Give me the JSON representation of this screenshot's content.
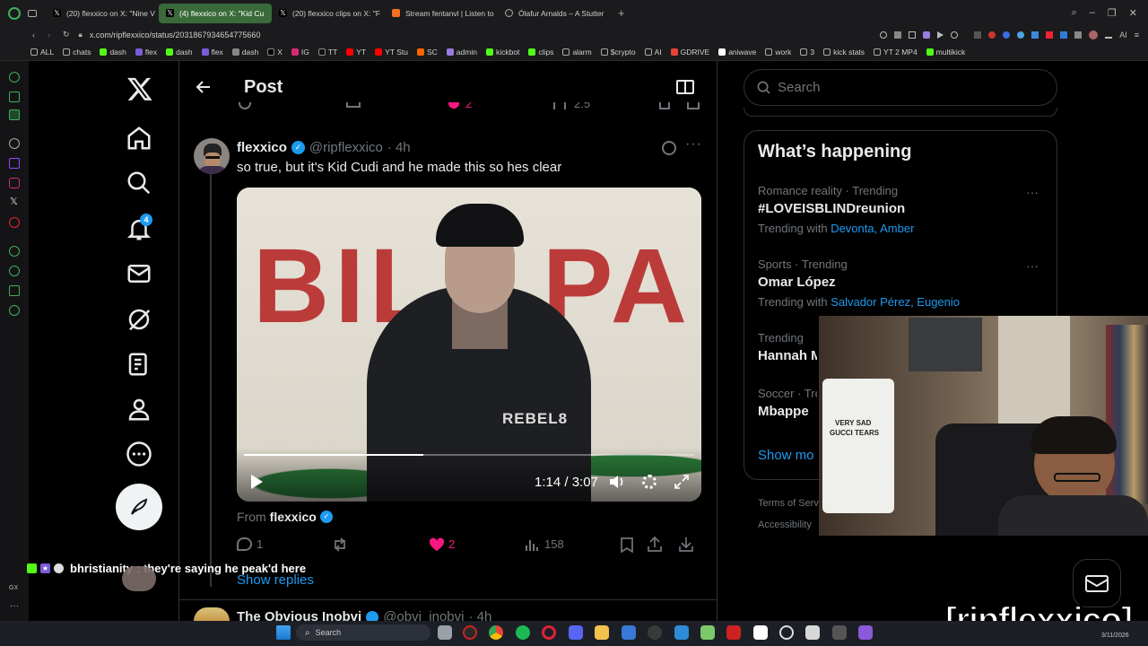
{
  "browser": {
    "tabs": [
      {
        "label": "(20) flexxico on X: \"Nine V",
        "active": false
      },
      {
        "label": "(4) flexxico on X: \"Kid Cu",
        "active": true
      },
      {
        "label": "(20) flexxico clips on X: \"F",
        "active": false
      },
      {
        "label": "Stream fentanvl | Listen to",
        "active": false
      },
      {
        "label": "Ólafur Arnalds – A Stutter",
        "active": false
      }
    ],
    "url": "x.com/ripflexxico/status/2031867934654775660",
    "bookmarks": [
      "ALL",
      "chats",
      "dash",
      "flex",
      "dash",
      "flex",
      "dash",
      "X",
      "IG",
      "TT",
      "YT",
      "YT Stu",
      "SC",
      "admin",
      "kickbot",
      "clips",
      "alarm",
      "$crypto",
      "AI",
      "GDRIVE",
      "aniwave",
      "work",
      "3",
      "kick stats",
      "YT 2 MP4",
      "multikick"
    ],
    "ai_label": "AI"
  },
  "nav": {
    "notifications_count": "4"
  },
  "header": {
    "title": "Post"
  },
  "prev_tweet": {
    "likes": "2",
    "views": "2.5"
  },
  "tweet": {
    "display_name": "flexxico",
    "handle": "@ripflexxico",
    "time": "· 4h",
    "text": "so true, but it's Kid Cudi and he made this so hes clear",
    "video": {
      "time": "1:14 / 3:07",
      "progress": 0.398,
      "shirt_text": "REBEL8",
      "wall_text": "BILL PA"
    },
    "from_label": "From",
    "from_name": "flexxico",
    "stats": {
      "replies": "1",
      "likes": "2",
      "views": "158"
    }
  },
  "show_replies": "Show replies",
  "next_tweet": {
    "display_name": "The Obvious Inobvi",
    "handle": "@obvi_inobvi",
    "time": "· 4h"
  },
  "search": {
    "placeholder": "Search"
  },
  "trends": {
    "title": "What’s happening",
    "items": [
      {
        "meta": "Romance reality · Trending",
        "name": "#LOVEISBLINDreunion",
        "with_label": "Trending with",
        "with_names": "Devonta, Amber"
      },
      {
        "meta": "Sports · Trending",
        "name": "Omar López",
        "with_label": "Trending with",
        "with_names": "Salvador Pérez, Eugenio"
      },
      {
        "meta": "Trending",
        "name": "Hannah M",
        "with_label": "",
        "with_names": ""
      },
      {
        "meta": "Soccer · Tre",
        "name": "Mbappe",
        "with_label": "",
        "with_names": ""
      }
    ],
    "show_more": "Show mo"
  },
  "footer": {
    "terms": "Terms of Serv",
    "accessibility": "Accessibility"
  },
  "chat_overlay": {
    "username": "bhristianity",
    "message": ": they're saying he peak'd here"
  },
  "streamer_tag": "[ripflexxico]",
  "webcam": {
    "shirt_text_1": "VERY SAD",
    "shirt_text_2": "GUCCI TEARS"
  },
  "taskbar": {
    "search_label": "Search",
    "date": "3/11/2026"
  },
  "colors": {
    "accent": "#1d9bf0",
    "like": "#f91880",
    "bg": "#000000"
  }
}
